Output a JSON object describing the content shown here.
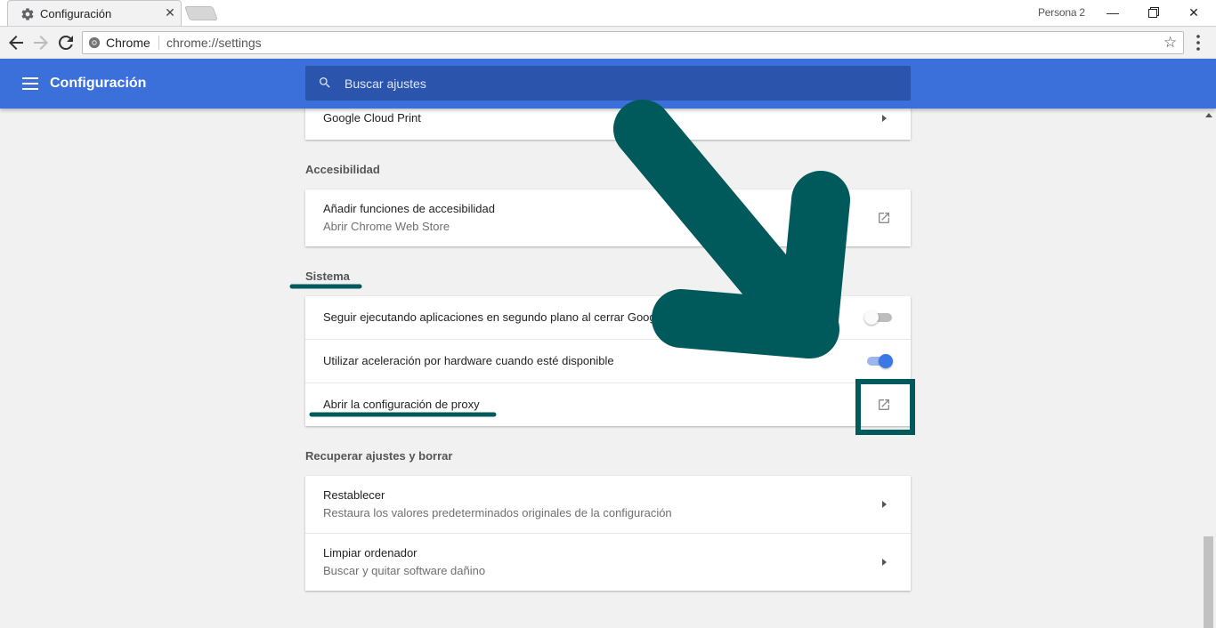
{
  "browser": {
    "tab_title": "Configuración",
    "profile": "Persona 2",
    "omnibox_site": "Chrome",
    "omnibox_url": "chrome://settings"
  },
  "header": {
    "title": "Configuración",
    "search_placeholder": "Buscar ajustes",
    "color": "#3b6fd9"
  },
  "sections": {
    "cloud_print": {
      "label": "Google Cloud Print"
    },
    "accessibility": {
      "heading": "Accesibilidad",
      "item_title": "Añadir funciones de accesibilidad",
      "item_sub": "Abrir Chrome Web Store"
    },
    "system": {
      "heading": "Sistema",
      "background_apps": "Seguir ejecutando aplicaciones en segundo plano al cerrar Goog",
      "background_apps_enabled": false,
      "hw_accel": "Utilizar aceleración por hardware cuando esté disponible",
      "hw_accel_enabled": true,
      "proxy": "Abrir la configuración de proxy"
    },
    "reset": {
      "heading": "Recuperar ajustes y borrar",
      "restore_title": "Restablecer",
      "restore_sub": "Restaura los valores predeterminados originales de la configuración",
      "clean_title": "Limpiar ordenador",
      "clean_sub": "Buscar y quitar software dañino"
    }
  },
  "annotation_color": "#005a5c"
}
